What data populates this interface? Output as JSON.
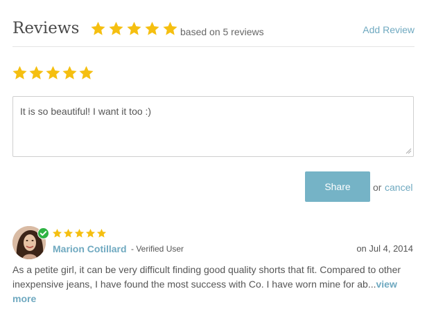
{
  "header": {
    "title": "Reviews",
    "summary_rating": 5,
    "summary_text": "based on 5 reviews",
    "add_review_label": "Add Review"
  },
  "form": {
    "rating_selected": 5,
    "review_text": "It is so beautiful! I want it too :)",
    "share_label": "Share",
    "or_label": "or",
    "cancel_label": "cancel"
  },
  "review": {
    "rating": 5,
    "author": "Marion Cotillard",
    "role": "- Verified User",
    "date": "on Jul 4, 2014",
    "body": "As a petite girl, it can be very difficult finding good quality shorts that fit. Compared to other inexpensive jeans, I have found the most success with Co. I have worn mine for ab...",
    "view_more_label": "view more",
    "verified": true
  },
  "colors": {
    "star": "#f5bf10",
    "accent": "#6fa9c0",
    "share_button": "#75b3c6",
    "verified": "#2fb344",
    "divider": "#e3e3e3"
  }
}
